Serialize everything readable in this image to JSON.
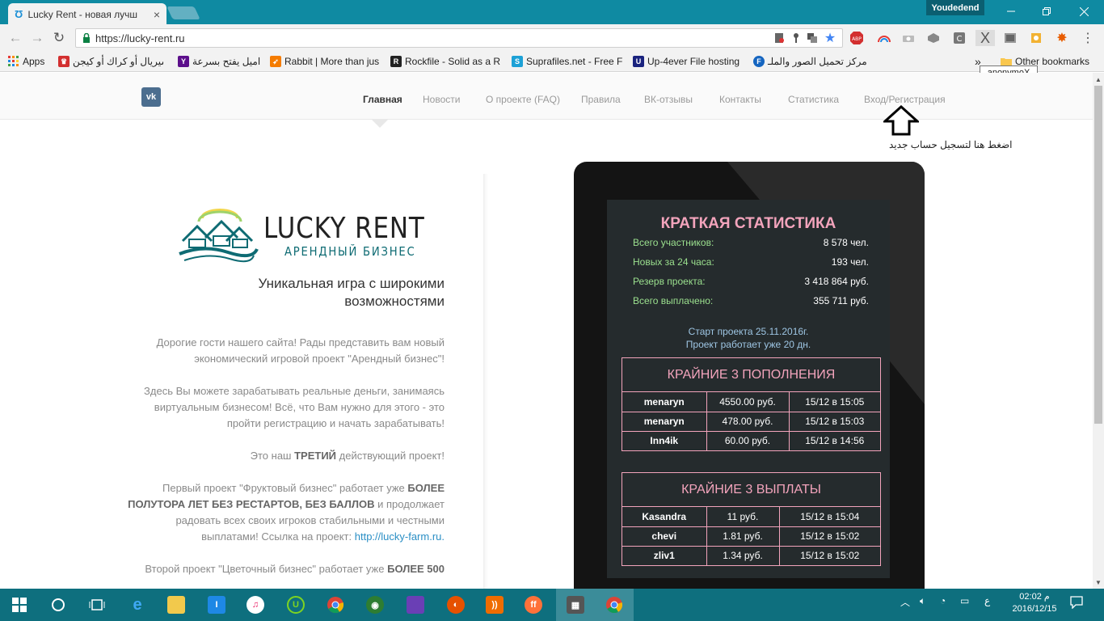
{
  "browser": {
    "tab_title": "Lucky Rent - новая лучш",
    "tab_close": "×",
    "profile_name": "Youdedend",
    "url": "https://lucky-rent.ru",
    "tooltip": "anonymoX",
    "bookmarks_overflow": "»",
    "other_bookmarks": "Other bookmarks",
    "bookmarks": [
      {
        "label": "Apps",
        "icon": "apps-grid-icon"
      },
      {
        "label": "سيريال أو كراك أو كيجن",
        "icon": "folder-crown-icon"
      },
      {
        "label": "اميل يفتح بسرعة",
        "icon": "yahoo-icon"
      },
      {
        "label": "Rabbit | More than jus",
        "icon": "rabbit-icon"
      },
      {
        "label": "Rockfile - Solid as a R",
        "icon": "rockfile-icon"
      },
      {
        "label": "Suprafiles.net - Free F",
        "icon": "suprafiles-icon"
      },
      {
        "label": "Up-4ever File hosting",
        "icon": "up4ever-icon"
      },
      {
        "label": "مركز تحميل الصور والملـ",
        "icon": "facebook-f-icon"
      }
    ]
  },
  "site": {
    "vk_label": "vk",
    "nav": [
      "Главная",
      "Новости",
      "О проекте (FAQ)",
      "Правила",
      "ВК-отзывы",
      "Контакты",
      "Статистика",
      "Вход/Регистрация"
    ],
    "annotation": "اضغط هنا لتسجيل حساب جديد",
    "brand_title": "LUCKY RENT",
    "brand_subtitle": "АРЕНДНЫЙ БИЗНЕС",
    "tagline": "Уникальная игра с широкими возможностями",
    "intro": {
      "p1": "Дорогие гости нашего сайта! Рады представить вам новый экономический игровой проект \"Арендный бизнес\"!",
      "p2": "Здесь Вы можете зарабатывать реальные деньги, занимаясь виртуальным бизнесом! Всё, что Вам нужно для этого - это пройти регистрацию и начать зарабатывать!",
      "p3_a": "Это наш ",
      "p3_b": "ТРЕТИЙ",
      "p3_c": " действующий проект!",
      "p4_a": "Первый проект \"Фруктовый бизнес\" работает уже ",
      "p4_b": "БОЛЕЕ ПОЛУТОРА ЛЕТ БЕЗ РЕСТАРТОВ, БЕЗ БАЛЛОВ",
      "p4_c": " и продолжает радовать всех своих игроков стабильными и честными выплатами! Ссылка на проект: ",
      "p4_link": "http://lucky-farm.ru.",
      "p5_a": "Второй проект \"Цветочный бизнес\" работает уже ",
      "p5_b": "БОЛЕЕ 500"
    },
    "stats": {
      "title": "КРАТКАЯ СТАТИСТИКА",
      "rows": [
        {
          "label": "Всего участников:",
          "value": "8 578 чел."
        },
        {
          "label": "Новых за 24 часа:",
          "value": "193 чел."
        },
        {
          "label": "Резерв проекта:",
          "value": "3 418 864 руб."
        },
        {
          "label": "Всего выплачено:",
          "value": "355 711 руб."
        }
      ],
      "start": "Старт проекта 25.11.2016г.",
      "running": "Проект работает уже 20 дн."
    },
    "deposits": {
      "title": "КРАЙНИЕ 3 ПОПОЛНЕНИЯ",
      "rows": [
        [
          "menaryn",
          "4550.00 руб.",
          "15/12 в 15:05"
        ],
        [
          "menaryn",
          "478.00 руб.",
          "15/12 в 15:03"
        ],
        [
          "Inn4ik",
          "60.00 руб.",
          "15/12 в 14:56"
        ]
      ]
    },
    "payouts": {
      "title": "КРАЙНИЕ 3 ВЫПЛАТЫ",
      "rows": [
        [
          "Kasandra",
          "11 руб.",
          "15/12 в 15:04"
        ],
        [
          "chevi",
          "1.81 руб.",
          "15/12 в 15:02"
        ],
        [
          "zliv1",
          "1.34 руб.",
          "15/12 в 15:02"
        ]
      ]
    }
  },
  "taskbar": {
    "lang": "ع",
    "time": "02:02 م",
    "date": "2016/12/15"
  },
  "colors": {
    "titlebar": "#0f8aa2",
    "taskbar": "#0e6f7e",
    "stat_pink": "#f3a4bc",
    "stat_green": "#9be08e",
    "stat_blue": "#9ec6e4"
  }
}
